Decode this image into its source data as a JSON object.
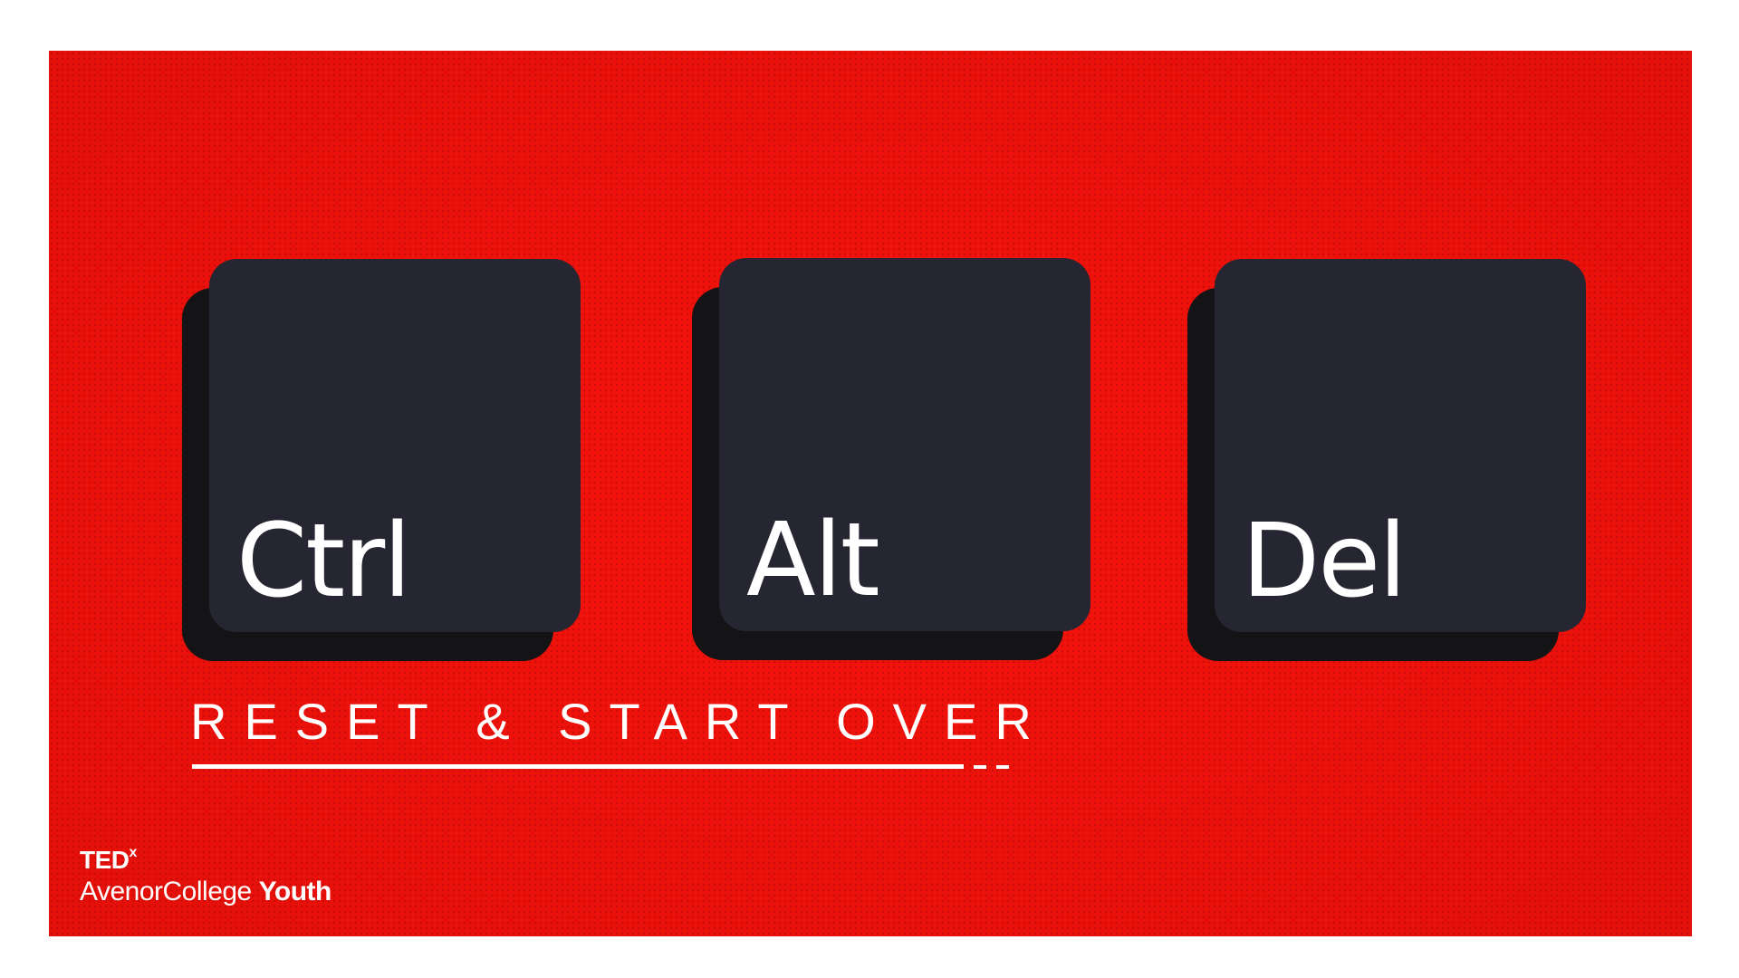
{
  "keys": [
    {
      "label": "Ctrl"
    },
    {
      "label": "Alt"
    },
    {
      "label": "Del"
    }
  ],
  "tagline": "RESET & START OVER",
  "logo": {
    "brand": "TED",
    "brand_superscript": "x",
    "event": "AvenorCollege",
    "event_bold": "Youth"
  },
  "colors": {
    "background": "#f5130c",
    "key_face": "#262633",
    "key_shadow": "#141417",
    "text": "#ffffff"
  }
}
